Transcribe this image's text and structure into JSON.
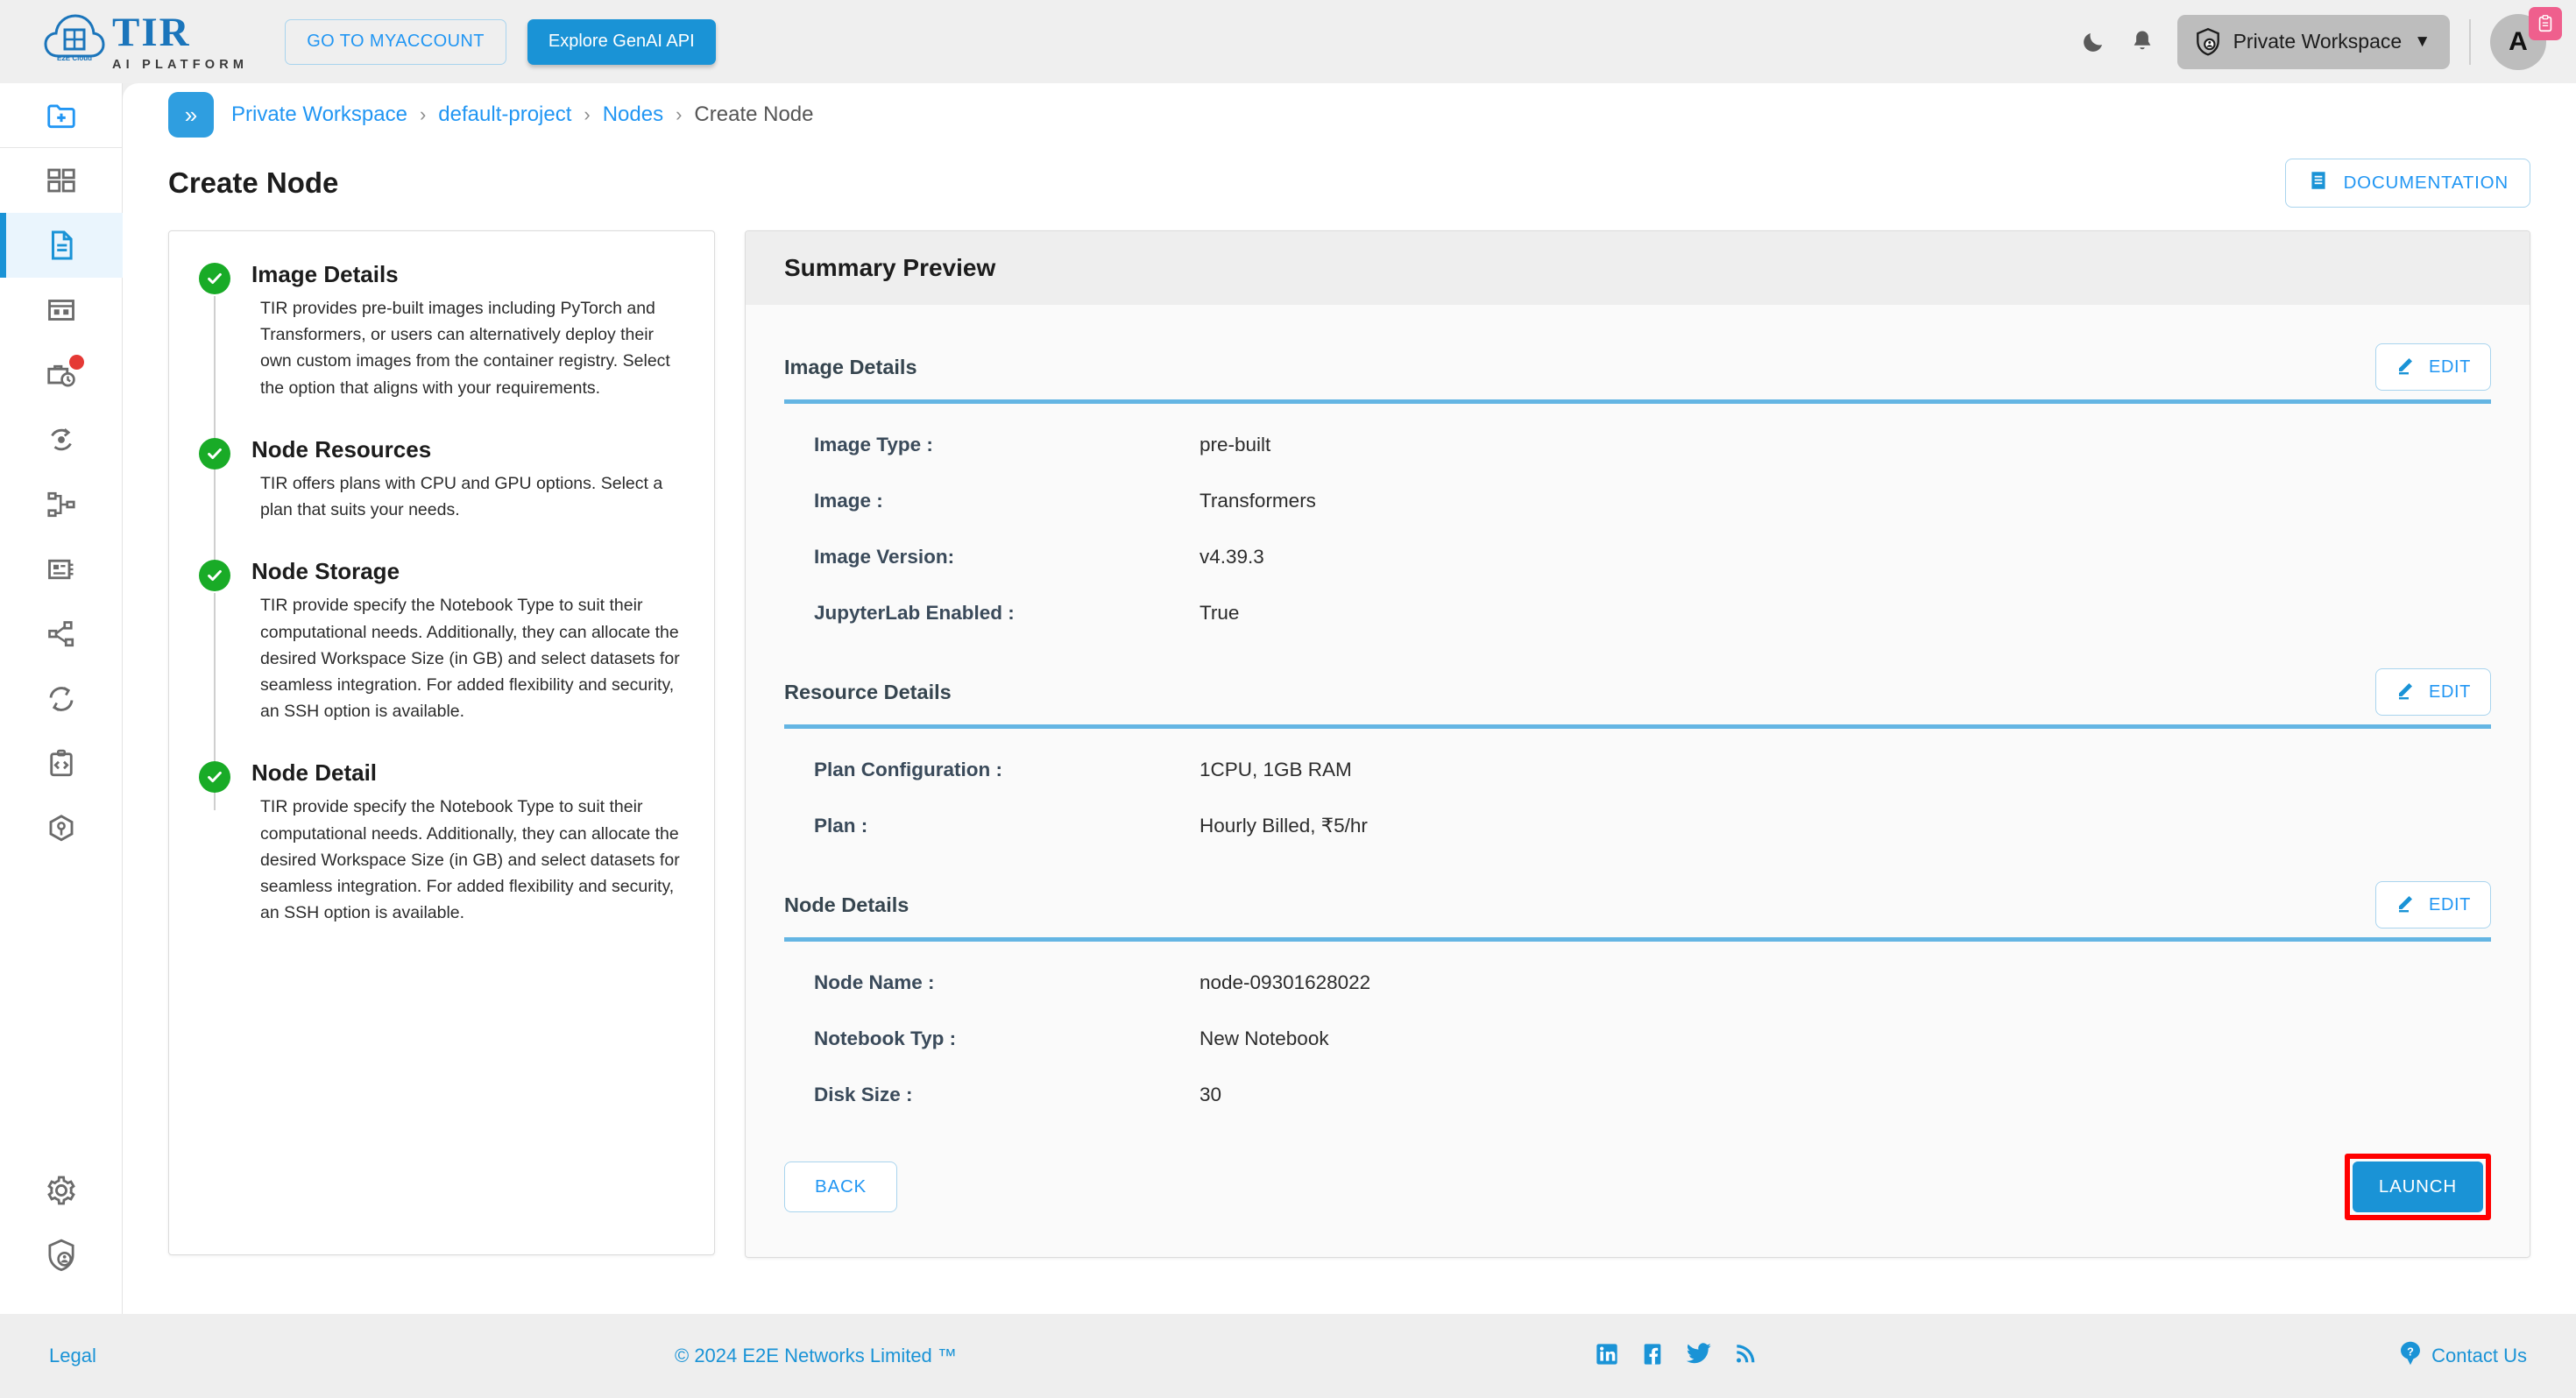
{
  "header": {
    "logo_title": "TIR",
    "logo_subtitle": "AI PLATFORM",
    "logo_cloud_label": "E2E Cloud",
    "myaccount_label": "GO TO MYACCOUNT",
    "genai_label": "Explore GenAI API",
    "dark_mode_icon": "moon-icon",
    "notifications_icon": "bell-icon",
    "workspace_label": "Private Workspace",
    "workspace_icon": "shield-user-icon",
    "workspace_caret": "▼",
    "avatar_initial": "A",
    "avatar_badge_icon": "clipboard-icon"
  },
  "breadcrumb": {
    "toggle_icon": "chevron-double-right-icon",
    "toggle_glyph": "»",
    "items": [
      {
        "label": "Private Workspace",
        "current": false
      },
      {
        "label": "default-project",
        "current": false
      },
      {
        "label": "Nodes",
        "current": false
      },
      {
        "label": "Create Node",
        "current": true
      }
    ],
    "separator": "›"
  },
  "page": {
    "title": "Create Node",
    "documentation_label": "DOCUMENTATION",
    "documentation_icon": "document-icon"
  },
  "sidebar": {
    "items": [
      {
        "icon": "folder-plus-icon",
        "active": false,
        "badge": false,
        "separator": true
      },
      {
        "icon": "dashboard-grid-icon",
        "active": false,
        "badge": false,
        "separator": false
      },
      {
        "icon": "document-icon",
        "active": true,
        "badge": false,
        "separator": false
      },
      {
        "icon": "table-icon",
        "active": false,
        "badge": false,
        "separator": false
      },
      {
        "icon": "briefcase-clock-icon",
        "active": false,
        "badge": true,
        "separator": false
      },
      {
        "icon": "pipeline-icon",
        "active": false,
        "badge": false,
        "separator": false
      },
      {
        "icon": "hierarchy-icon",
        "active": false,
        "badge": false,
        "separator": false
      },
      {
        "icon": "chip-icon",
        "active": false,
        "badge": false,
        "separator": false
      },
      {
        "icon": "share-nodes-icon",
        "active": false,
        "badge": false,
        "separator": false
      },
      {
        "icon": "sync-icon",
        "active": false,
        "badge": false,
        "separator": false
      },
      {
        "icon": "code-clipboard-icon",
        "active": false,
        "badge": false,
        "separator": false
      },
      {
        "icon": "cube-icon",
        "active": false,
        "badge": false,
        "separator": false
      }
    ],
    "bottom_items": [
      {
        "icon": "gear-icon"
      },
      {
        "icon": "shield-user-icon"
      }
    ]
  },
  "steps": [
    {
      "title": "Image Details",
      "description": "TIR provides pre-built images including PyTorch and Transformers, or users can alternatively deploy their own custom images from the container registry. Select the option that aligns with your requirements.",
      "status": "complete"
    },
    {
      "title": "Node Resources",
      "description": "TIR offers plans with CPU and GPU options. Select a plan that suits your needs.",
      "status": "complete"
    },
    {
      "title": "Node Storage",
      "description": "TIR provide specify the Notebook Type to suit their computational needs. Additionally, they can allocate the desired Workspace Size (in GB) and select datasets for seamless integration. For added flexibility and security, an SSH option is available.",
      "status": "complete"
    },
    {
      "title": "Node Detail",
      "description": "TIR provide specify the Notebook Type to suit their computational needs. Additionally, they can allocate the desired Workspace Size (in GB) and select datasets for seamless integration. For added flexibility and security, an SSH option is available.",
      "status": "complete"
    }
  ],
  "summary": {
    "title": "Summary Preview",
    "edit_label": "EDIT",
    "edit_icon": "pencil-icon",
    "sections": [
      {
        "title": "Image Details",
        "rows": [
          {
            "key": "Image Type :",
            "value": "pre-built"
          },
          {
            "key": "Image :",
            "value": "Transformers"
          },
          {
            "key": "Image Version:",
            "value": "v4.39.3"
          },
          {
            "key": "JupyterLab Enabled :",
            "value": "True"
          }
        ]
      },
      {
        "title": "Resource Details",
        "rows": [
          {
            "key": "Plan Configuration :",
            "value": "1CPU, 1GB RAM"
          },
          {
            "key": "Plan :",
            "value": "Hourly Billed, ₹5/hr"
          }
        ]
      },
      {
        "title": "Node Details",
        "rows": [
          {
            "key": "Node Name :",
            "value": "node-09301628022"
          },
          {
            "key": "Notebook Typ :",
            "value": "New Notebook"
          },
          {
            "key": "Disk Size :",
            "value": "30"
          }
        ]
      }
    ],
    "back_label": "BACK",
    "launch_label": "LAUNCH",
    "launch_highlight_color": "#ff0000"
  },
  "footer": {
    "legal_label": "Legal",
    "copyright": "© 2024 E2E Networks Limited ™",
    "contact_label": "Contact Us",
    "contact_icon": "question-circle-icon",
    "social": [
      {
        "icon": "linkedin-icon"
      },
      {
        "icon": "facebook-icon"
      },
      {
        "icon": "twitter-icon"
      },
      {
        "icon": "rss-icon"
      }
    ]
  },
  "colors": {
    "accent_blue": "#1a93d6",
    "link_blue": "#2196f3",
    "step_green": "#19ab27",
    "badge_pink": "#ef5f8d",
    "highlight_red": "#ff0000",
    "rule_blue": "#64b5e3"
  }
}
